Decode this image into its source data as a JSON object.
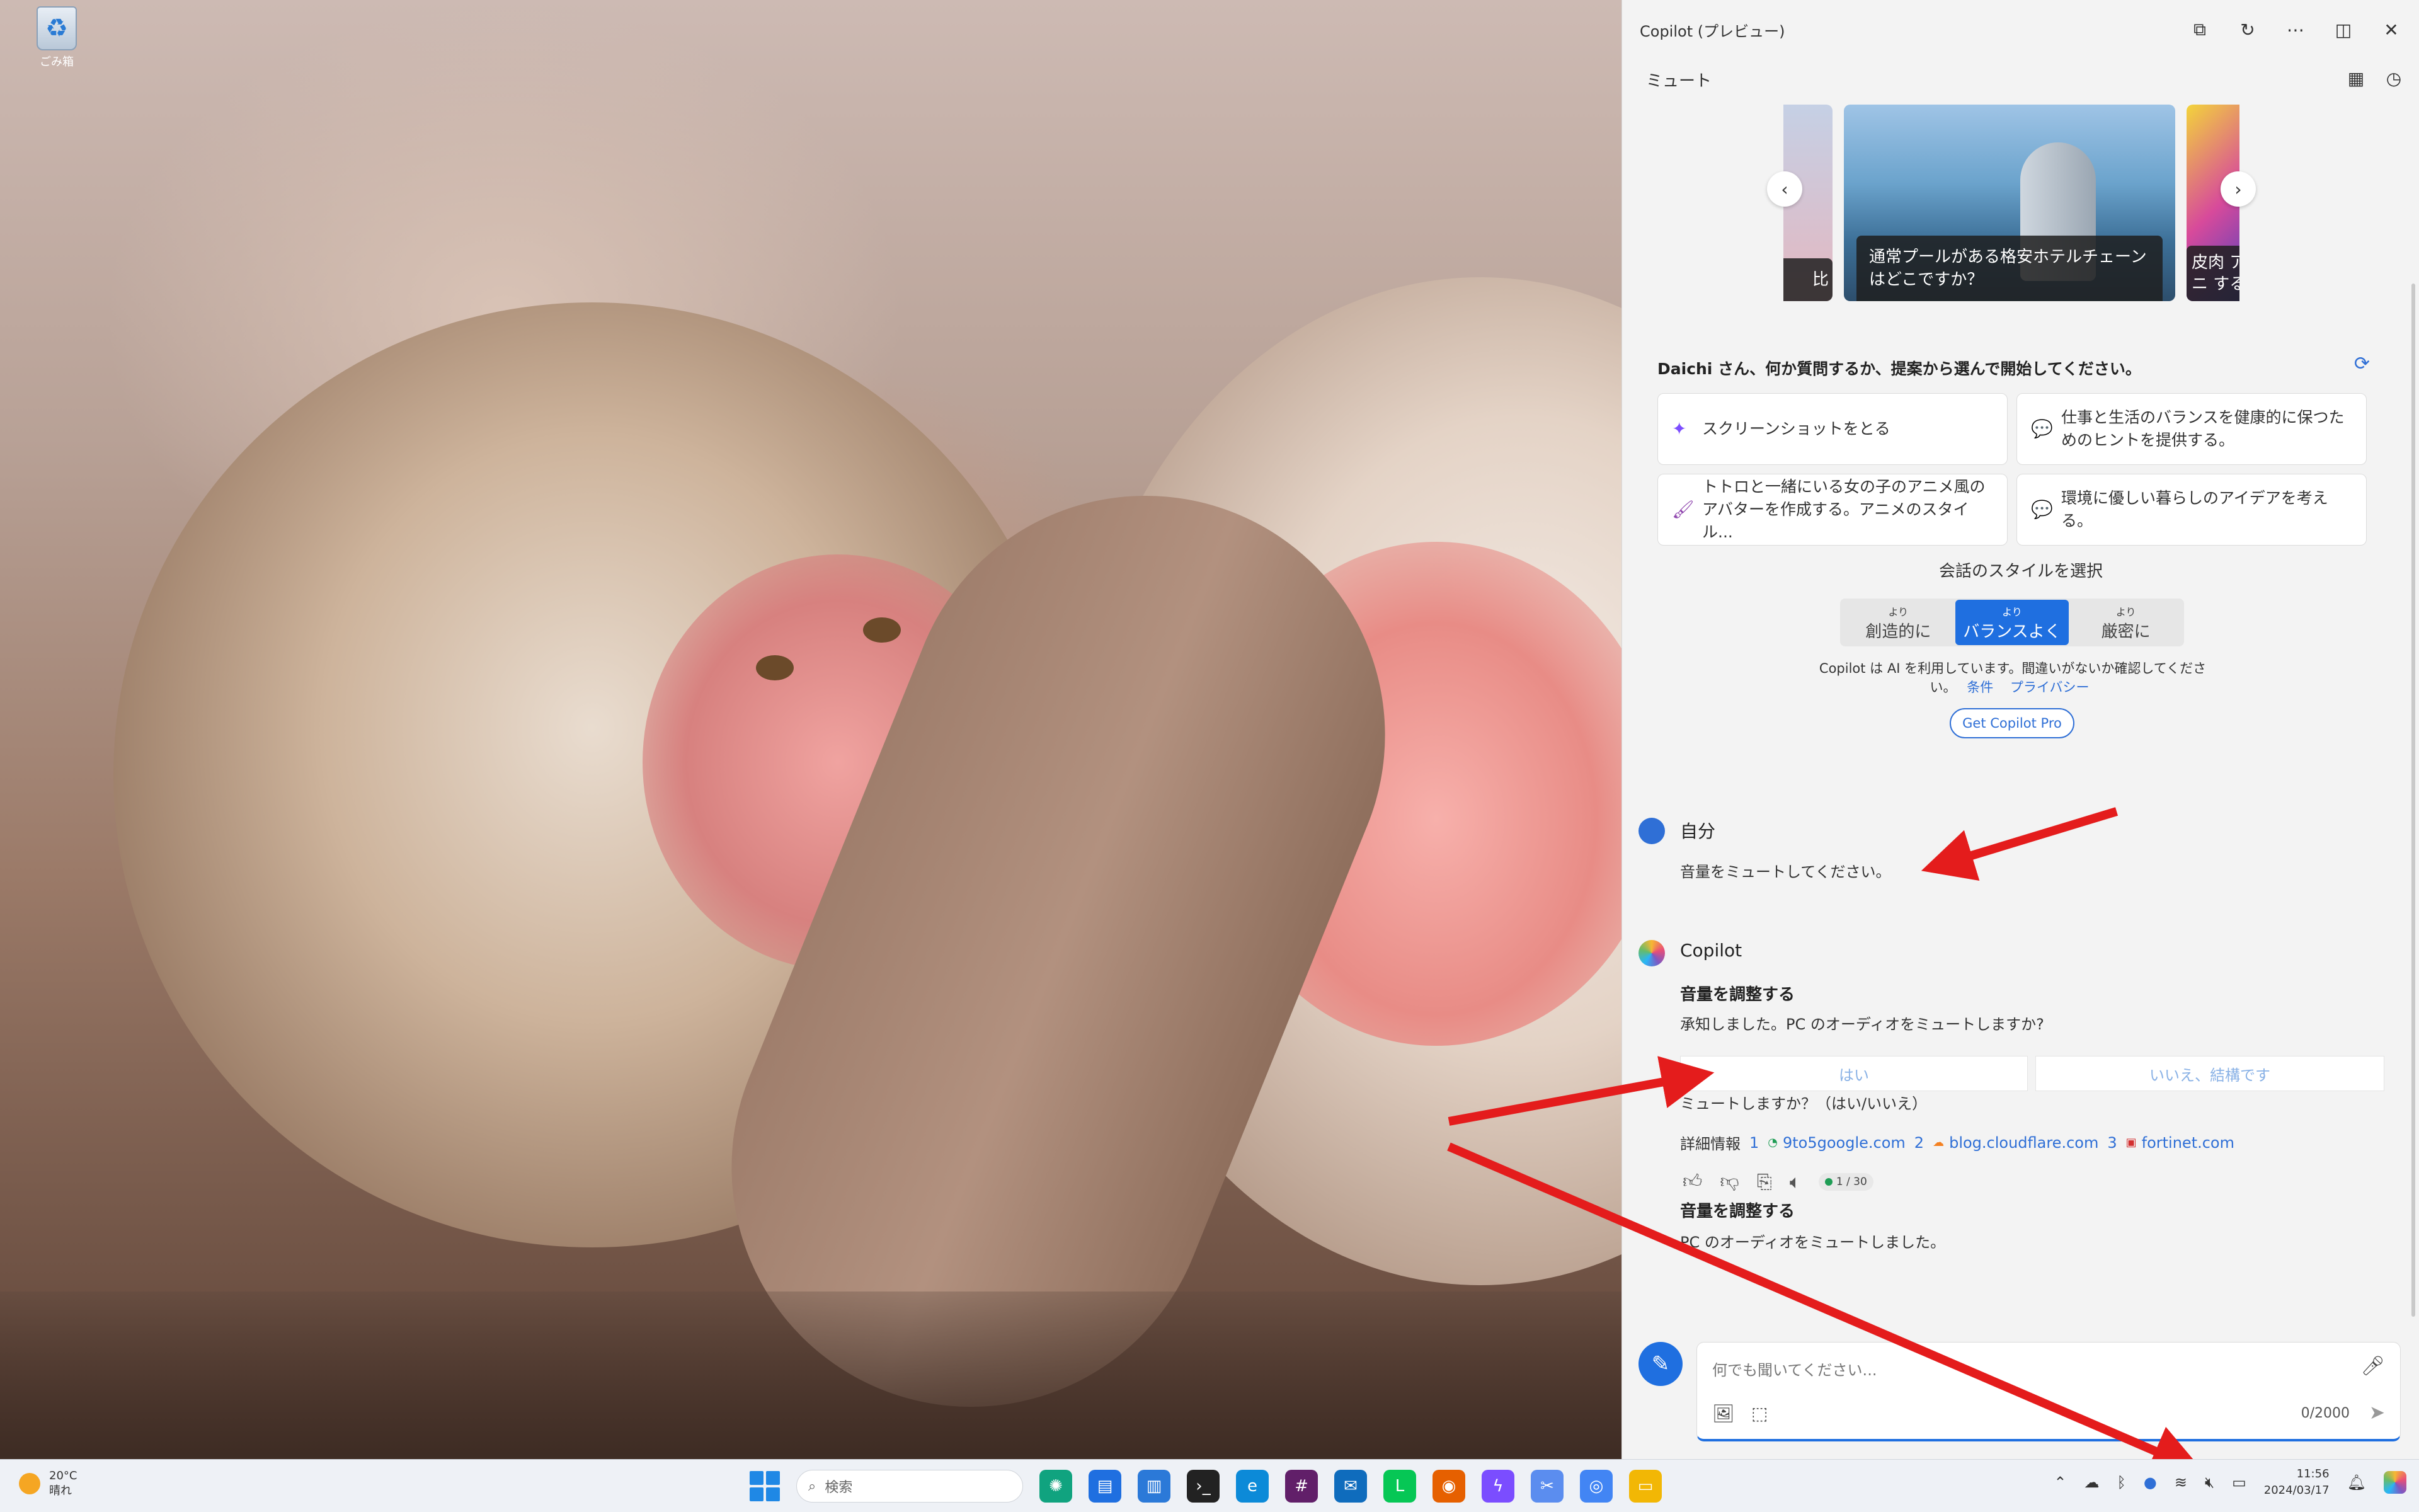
{
  "desktop": {
    "recycle_bin_label": "ごみ箱"
  },
  "copilot": {
    "window_title": "Copilot (プレビュー)",
    "header_label": "ミュート",
    "carousel": [
      {
        "caption": "比"
      },
      {
        "caption": "通常プールがある格安ホテルチェーンはどこですか？"
      },
      {
        "caption": "皮肉 アニ する"
      }
    ],
    "greeting": "Daichi さん、何か質問するか、提案から選んで開始してください。",
    "suggestions": [
      {
        "label": "スクリーンショットをとる",
        "icon": "sparkle-icon"
      },
      {
        "label": "仕事と生活のバランスを健康的に保つためのヒントを提供する。",
        "icon": "chat-icon"
      },
      {
        "label": "トトロと一緒にいる女の子のアニメ風のアバターを作成する。アニメのスタイル...",
        "icon": "image-icon"
      },
      {
        "label": "環境に優しい暮らしのアイデアを考える。",
        "icon": "chat-icon"
      }
    ],
    "style_label": "会話のスタイルを選択",
    "styles": [
      {
        "small": "より",
        "big": "創造的に"
      },
      {
        "small": "より",
        "big": "バランスよく"
      },
      {
        "small": "より",
        "big": "厳密に"
      }
    ],
    "active_style": "バランスよく",
    "disclaimer": "Copilot は AI を利用しています。間違いがないか確認してください。",
    "terms_link": "条件",
    "privacy_link": "プライバシー",
    "pro_button": "Get Copilot Pro",
    "user_name": "自分",
    "user_message": "音量をミュートしてください。",
    "assistant_name": "Copilot",
    "response1_title": "音量を調整する",
    "response1_text": "承知しました。PC のオーディオをミュートしますか?",
    "choice_yes": "はい",
    "choice_no": "いいえ、結構です",
    "choice_result": "ミュートしますか？（はい/いいえ）",
    "sources_label": "詳細情報",
    "sources": [
      {
        "num": "1",
        "domain": "9to5google.com"
      },
      {
        "num": "2",
        "domain": "blog.cloudflare.com"
      },
      {
        "num": "3",
        "domain": "fortinet.com"
      }
    ],
    "turn_counter": "1 / 30",
    "response2_title": "音量を調整する",
    "response2_text": "PC のオーディオをミュートしました。",
    "input_placeholder": "何でも聞いてください...",
    "char_count": "0/2000",
    "accent_color": "#1f6fe0"
  },
  "taskbar": {
    "weather_temp": "20°C",
    "weather_desc": "晴れ",
    "search_placeholder": "検索",
    "time": "11:56",
    "date": "2024/03/17"
  }
}
